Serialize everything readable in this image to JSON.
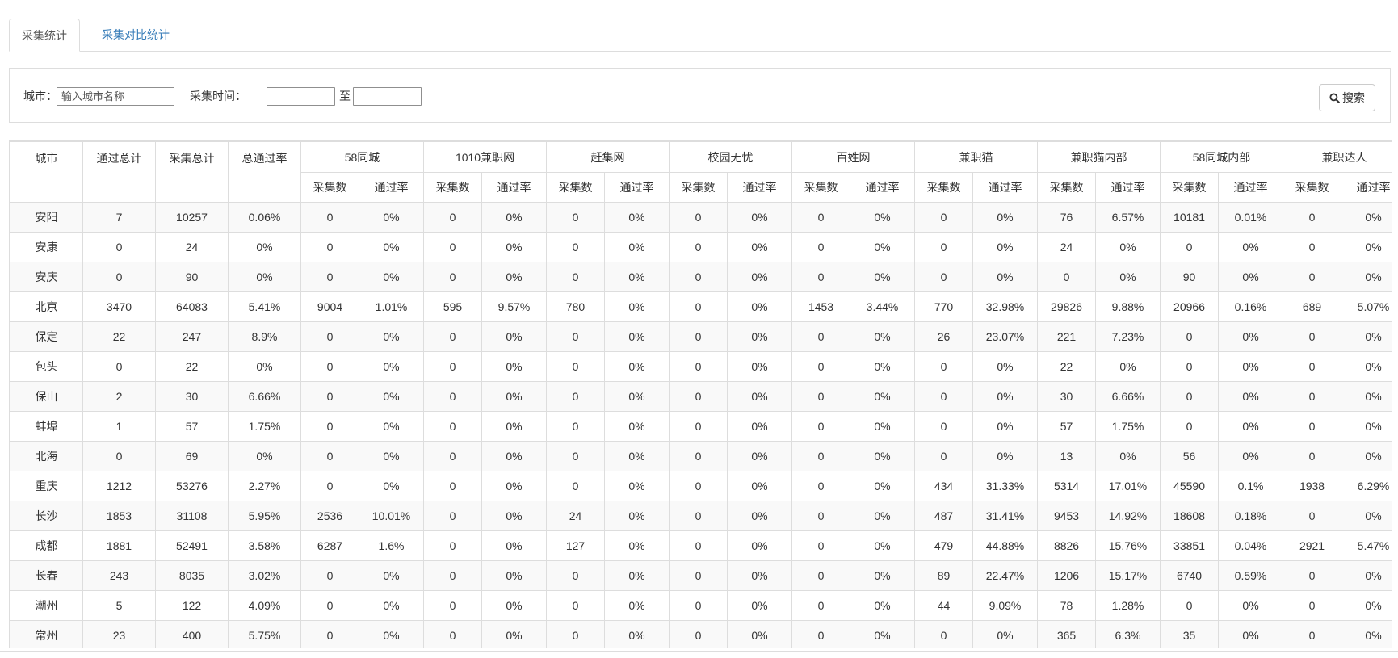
{
  "tabs": [
    {
      "label": "采集统计",
      "active": true
    },
    {
      "label": "采集对比统计",
      "active": false
    }
  ],
  "filter": {
    "city_label": "城市：",
    "city_placeholder": "输入城市名称",
    "time_label": "采集时间：",
    "to_label": "至",
    "search_label": "搜索",
    "search_icon": "magnifier-icon"
  },
  "table": {
    "fixed_headers": [
      "城市",
      "通过总计",
      "采集总计",
      "总通过率"
    ],
    "sources": [
      "58同城",
      "1010兼职网",
      "赶集网",
      "校园无忧",
      "百姓网",
      "兼职猫",
      "兼职猫内部",
      "58同城内部",
      "兼职达人"
    ],
    "sub_headers": [
      "采集数",
      "通过率"
    ],
    "rows": [
      [
        "安阳",
        "7",
        "10257",
        "0.06%",
        "0",
        "0%",
        "0",
        "0%",
        "0",
        "0%",
        "0",
        "0%",
        "0",
        "0%",
        "0",
        "0%",
        "76",
        "6.57%",
        "10181",
        "0.01%",
        "0",
        "0%"
      ],
      [
        "安康",
        "0",
        "24",
        "0%",
        "0",
        "0%",
        "0",
        "0%",
        "0",
        "0%",
        "0",
        "0%",
        "0",
        "0%",
        "0",
        "0%",
        "24",
        "0%",
        "0",
        "0%",
        "0",
        "0%"
      ],
      [
        "安庆",
        "0",
        "90",
        "0%",
        "0",
        "0%",
        "0",
        "0%",
        "0",
        "0%",
        "0",
        "0%",
        "0",
        "0%",
        "0",
        "0%",
        "0",
        "0%",
        "90",
        "0%",
        "0",
        "0%"
      ],
      [
        "北京",
        "3470",
        "64083",
        "5.41%",
        "9004",
        "1.01%",
        "595",
        "9.57%",
        "780",
        "0%",
        "0",
        "0%",
        "1453",
        "3.44%",
        "770",
        "32.98%",
        "29826",
        "9.88%",
        "20966",
        "0.16%",
        "689",
        "5.07%"
      ],
      [
        "保定",
        "22",
        "247",
        "8.9%",
        "0",
        "0%",
        "0",
        "0%",
        "0",
        "0%",
        "0",
        "0%",
        "0",
        "0%",
        "26",
        "23.07%",
        "221",
        "7.23%",
        "0",
        "0%",
        "0",
        "0%"
      ],
      [
        "包头",
        "0",
        "22",
        "0%",
        "0",
        "0%",
        "0",
        "0%",
        "0",
        "0%",
        "0",
        "0%",
        "0",
        "0%",
        "0",
        "0%",
        "22",
        "0%",
        "0",
        "0%",
        "0",
        "0%"
      ],
      [
        "保山",
        "2",
        "30",
        "6.66%",
        "0",
        "0%",
        "0",
        "0%",
        "0",
        "0%",
        "0",
        "0%",
        "0",
        "0%",
        "0",
        "0%",
        "30",
        "6.66%",
        "0",
        "0%",
        "0",
        "0%"
      ],
      [
        "蚌埠",
        "1",
        "57",
        "1.75%",
        "0",
        "0%",
        "0",
        "0%",
        "0",
        "0%",
        "0",
        "0%",
        "0",
        "0%",
        "0",
        "0%",
        "57",
        "1.75%",
        "0",
        "0%",
        "0",
        "0%"
      ],
      [
        "北海",
        "0",
        "69",
        "0%",
        "0",
        "0%",
        "0",
        "0%",
        "0",
        "0%",
        "0",
        "0%",
        "0",
        "0%",
        "0",
        "0%",
        "13",
        "0%",
        "56",
        "0%",
        "0",
        "0%"
      ],
      [
        "重庆",
        "1212",
        "53276",
        "2.27%",
        "0",
        "0%",
        "0",
        "0%",
        "0",
        "0%",
        "0",
        "0%",
        "0",
        "0%",
        "434",
        "31.33%",
        "5314",
        "17.01%",
        "45590",
        "0.1%",
        "1938",
        "6.29%"
      ],
      [
        "长沙",
        "1853",
        "31108",
        "5.95%",
        "2536",
        "10.01%",
        "0",
        "0%",
        "24",
        "0%",
        "0",
        "0%",
        "0",
        "0%",
        "487",
        "31.41%",
        "9453",
        "14.92%",
        "18608",
        "0.18%",
        "0",
        "0%"
      ],
      [
        "成都",
        "1881",
        "52491",
        "3.58%",
        "6287",
        "1.6%",
        "0",
        "0%",
        "127",
        "0%",
        "0",
        "0%",
        "0",
        "0%",
        "479",
        "44.88%",
        "8826",
        "15.76%",
        "33851",
        "0.04%",
        "2921",
        "5.47%"
      ],
      [
        "长春",
        "243",
        "8035",
        "3.02%",
        "0",
        "0%",
        "0",
        "0%",
        "0",
        "0%",
        "0",
        "0%",
        "0",
        "0%",
        "89",
        "22.47%",
        "1206",
        "15.17%",
        "6740",
        "0.59%",
        "0",
        "0%"
      ],
      [
        "潮州",
        "5",
        "122",
        "4.09%",
        "0",
        "0%",
        "0",
        "0%",
        "0",
        "0%",
        "0",
        "0%",
        "0",
        "0%",
        "44",
        "9.09%",
        "78",
        "1.28%",
        "0",
        "0%",
        "0",
        "0%"
      ],
      [
        "常州",
        "23",
        "400",
        "5.75%",
        "0",
        "0%",
        "0",
        "0%",
        "0",
        "0%",
        "0",
        "0%",
        "0",
        "0%",
        "0",
        "0%",
        "365",
        "6.3%",
        "35",
        "0%",
        "0",
        "0%"
      ]
    ]
  }
}
